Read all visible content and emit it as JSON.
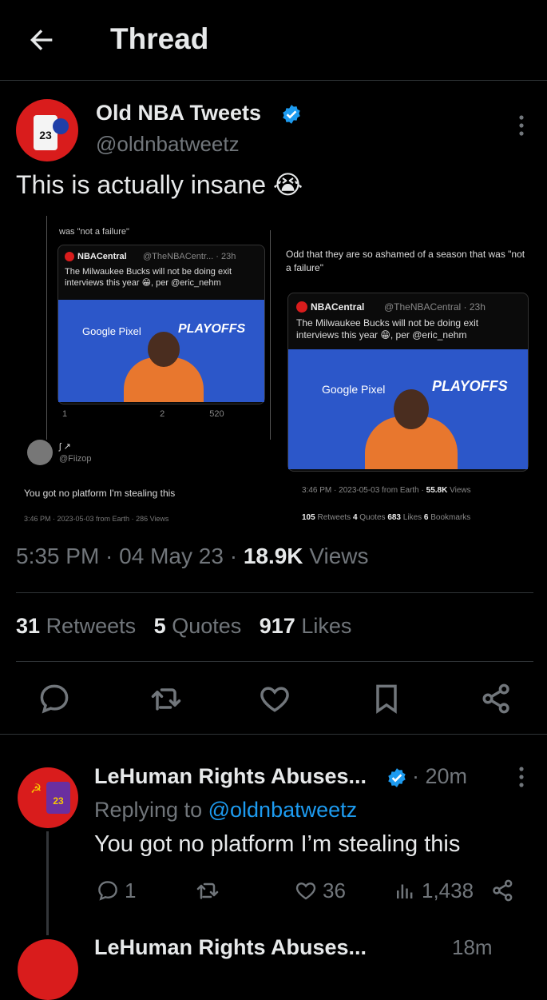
{
  "header": {
    "title": "Thread"
  },
  "tweet": {
    "name": "Old NBA Tweets",
    "handle": "@oldnbatweetz",
    "text": "This is actually insane 😭",
    "time": "5:35 PM",
    "date": "04 May 23",
    "views_count": "18.9K",
    "views_label": "Views",
    "retweets_count": "31",
    "retweets_label": "Retweets",
    "quotes_count": "5",
    "quotes_label": "Quotes",
    "likes_count": "917",
    "likes_label": "Likes"
  },
  "media": {
    "left": {
      "top_text": "was \"not a failure\"",
      "quoted_name": "NBACentral",
      "quoted_handle": "@TheNBACentr... · 23h",
      "quoted_text": "The Milwaukee Bucks will not be doing exit interviews this year 😁, per @eric_nehm",
      "replies": "1",
      "likes": "2",
      "views": "520",
      "user_handle": "@Fiizop",
      "user_name": "ʃ ↗",
      "reply_text": "You got no platform I'm stealing this",
      "footer": "3:46 PM · 2023-05-03 from Earth · 286 Views",
      "sponsor": "Google Pixel",
      "banner": "PLAYOFFS"
    },
    "right": {
      "text": "Odd that they are so ashamed of a season that was \"not a failure\"",
      "quoted_name": "NBACentral",
      "quoted_handle": "@TheNBACentral · 23h",
      "quoted_text": "The Milwaukee Bucks will not be doing exit interviews this year 😁, per @eric_nehm",
      "footer_prefix": "3:46 PM · 2023-05-03 from Earth ·",
      "footer_views": "55.8K",
      "footer_views_label": "Views",
      "retweets": "105",
      "retweets_label": "Retweets",
      "quotes": "4",
      "quotes_label": "Quotes",
      "likes": "683",
      "likes_label": "Likes",
      "bookmarks": "6",
      "bookmarks_label": "Bookmarks",
      "sponsor": "Google Pixel",
      "banner": "PLAYOFFS"
    }
  },
  "reply": {
    "name": "LeHuman Rights Abuses...",
    "time": "· 20m",
    "replying_prefix": "Replying to",
    "replying_handle": "@oldnbatweetz",
    "text": "You got no platform I’m stealing this",
    "replies": "1",
    "likes": "36",
    "views": "1,438"
  },
  "next_reply": {
    "name": "LeHuman Rights Abuses...",
    "time": "18m"
  },
  "colors": {
    "accent": "#1d9bf0",
    "muted": "#71767b",
    "divider": "#2f3336",
    "avatar_bg": "#d91c1c"
  }
}
